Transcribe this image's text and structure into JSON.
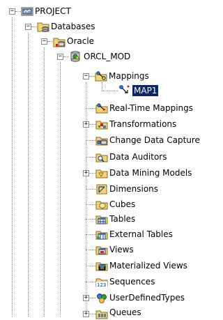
{
  "tree": {
    "colors": {
      "selection_bg": "#0a246a",
      "selection_text": "#ffffff",
      "connector": "#8a8a8a"
    },
    "nodes": [
      {
        "label": "PROJECT",
        "icon": "project-icon",
        "expander": "minus"
      },
      {
        "label": "Databases",
        "icon": "databases-folder-icon",
        "expander": "minus"
      },
      {
        "label": "Oracle",
        "icon": "oracle-folder-icon",
        "expander": "minus"
      },
      {
        "label": "ORCL_MOD",
        "icon": "oracle-module-icon",
        "expander": "minus"
      },
      {
        "label": "Mappings",
        "icon": "mappings-icon",
        "expander": "minus"
      },
      {
        "label": "MAP1",
        "icon": "map-icon",
        "expander": null,
        "selected": true
      },
      {
        "label": "Real-Time Mappings",
        "icon": "realtime-mappings-icon",
        "expander": null
      },
      {
        "label": "Transformations",
        "icon": "transformations-icon",
        "expander": "plus"
      },
      {
        "label": "Change Data Capture",
        "icon": "change-data-capture-icon",
        "expander": null
      },
      {
        "label": "Data Auditors",
        "icon": "data-auditors-icon",
        "expander": null
      },
      {
        "label": "Data Mining Models",
        "icon": "data-mining-models-icon",
        "expander": "plus"
      },
      {
        "label": "Dimensions",
        "icon": "dimensions-icon",
        "expander": null
      },
      {
        "label": "Cubes",
        "icon": "cubes-icon",
        "expander": null
      },
      {
        "label": "Tables",
        "icon": "tables-icon",
        "expander": null
      },
      {
        "label": "External Tables",
        "icon": "external-tables-icon",
        "expander": null
      },
      {
        "label": "Views",
        "icon": "views-icon",
        "expander": null
      },
      {
        "label": "Materialized Views",
        "icon": "materialized-views-icon",
        "expander": null
      },
      {
        "label": "Sequences",
        "icon": "sequences-icon",
        "expander": null
      },
      {
        "label": "UserDefinedTypes",
        "icon": "user-defined-types-icon",
        "expander": "plus"
      },
      {
        "label": "Queues",
        "icon": "queues-icon",
        "expander": "plus"
      }
    ]
  }
}
